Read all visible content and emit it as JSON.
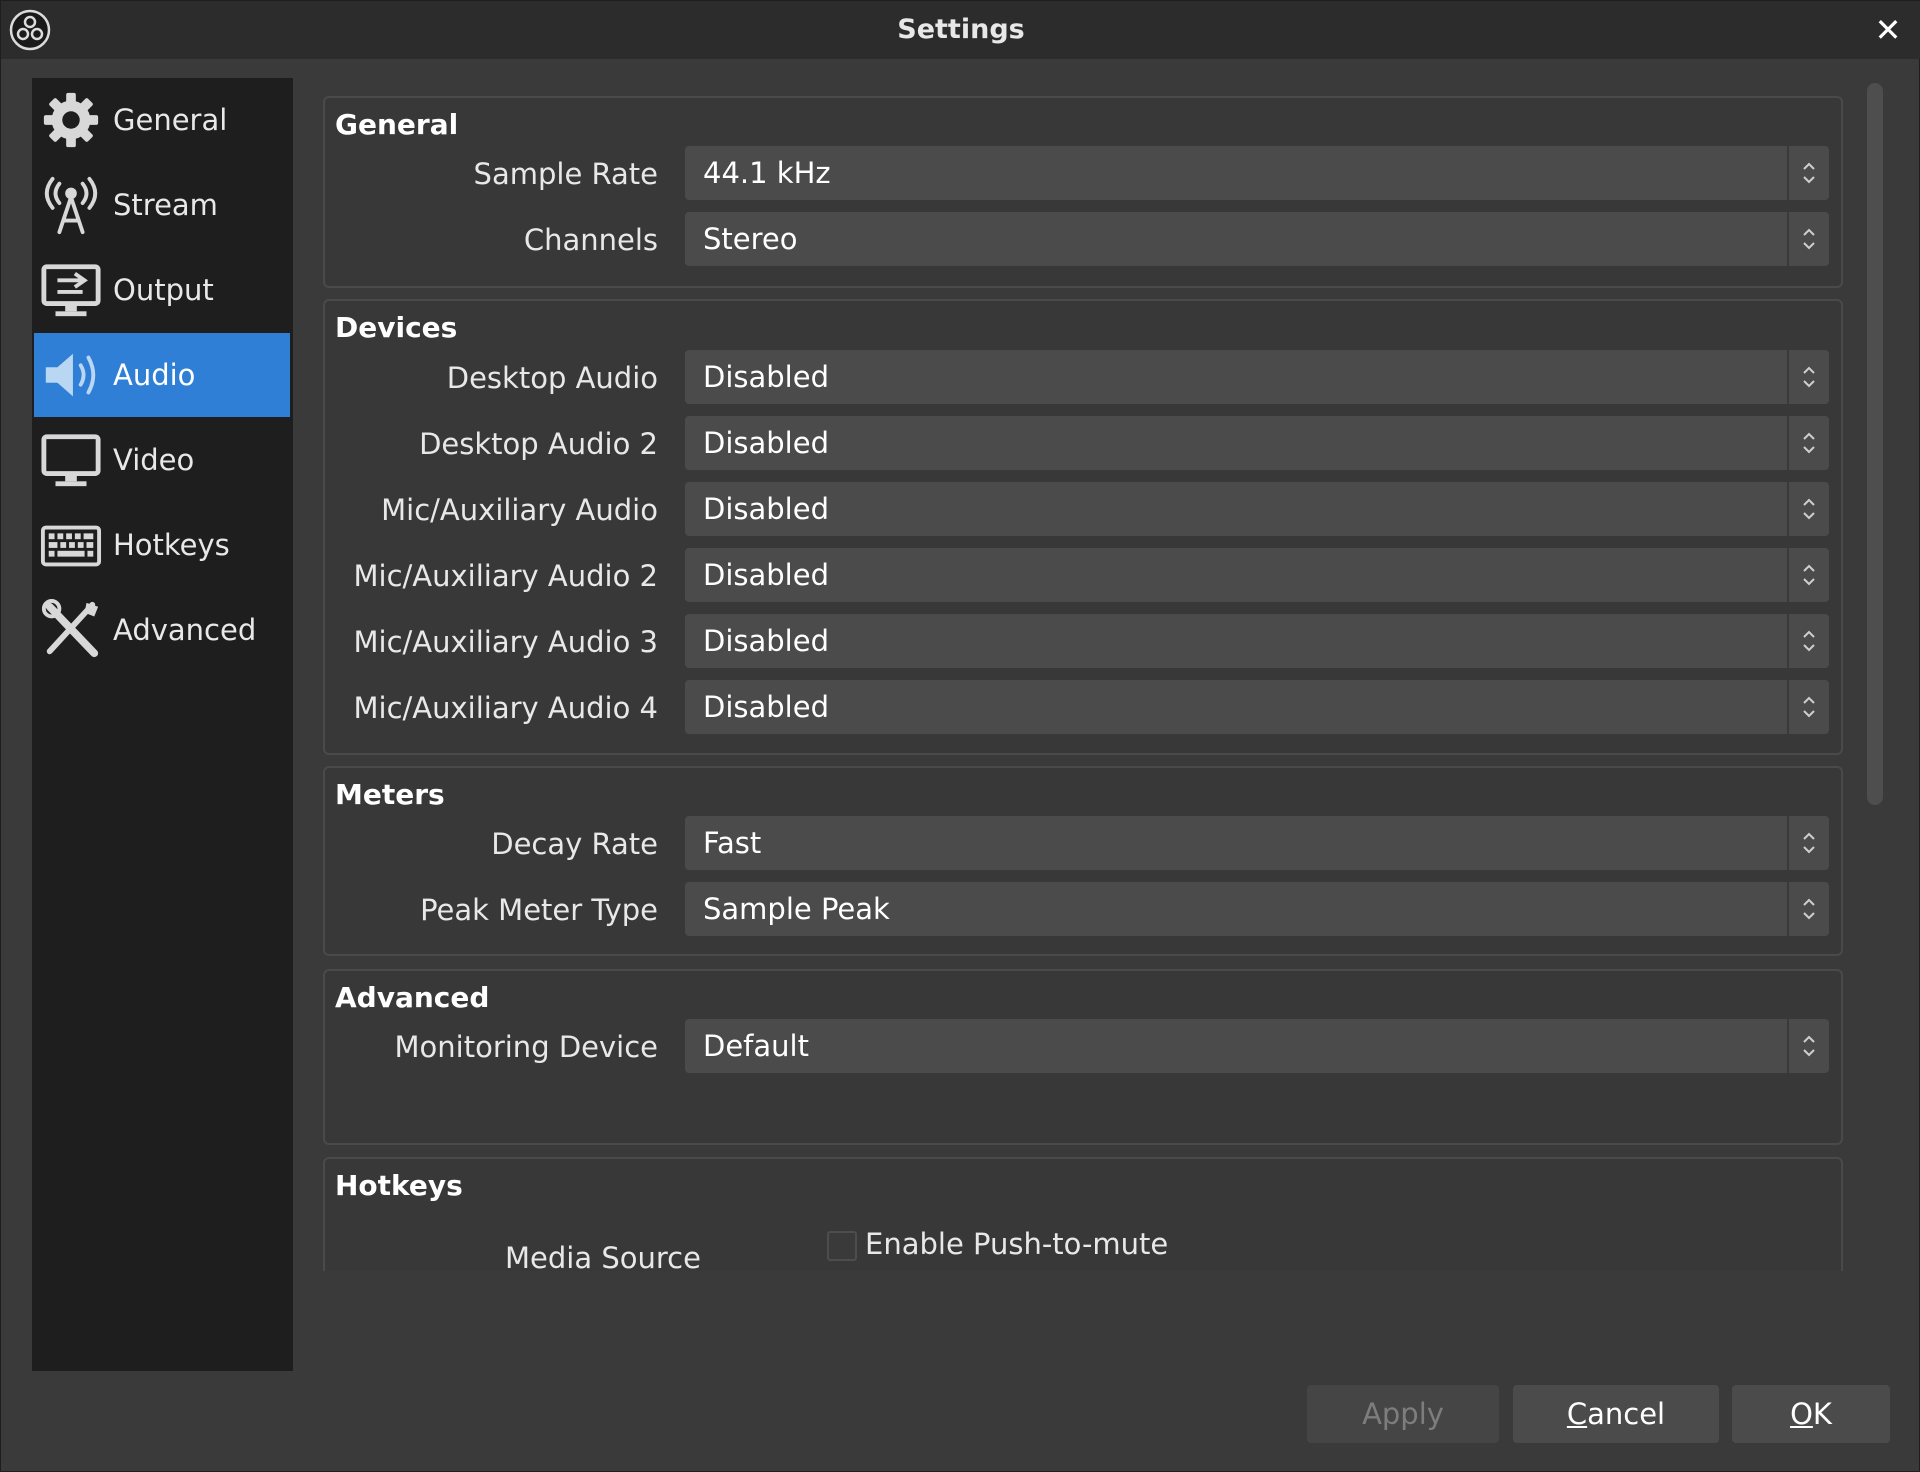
{
  "window": {
    "title": "Settings"
  },
  "sidebar": {
    "items": [
      {
        "label": "General",
        "icon": "gear-icon"
      },
      {
        "label": "Stream",
        "icon": "antenna-icon"
      },
      {
        "label": "Output",
        "icon": "output-icon"
      },
      {
        "label": "Audio",
        "icon": "speaker-icon",
        "selected": true
      },
      {
        "label": "Video",
        "icon": "monitor-icon"
      },
      {
        "label": "Hotkeys",
        "icon": "keyboard-icon"
      },
      {
        "label": "Advanced",
        "icon": "tools-icon"
      }
    ]
  },
  "sections": {
    "general": {
      "title": "General",
      "sample_rate": {
        "label": "Sample Rate",
        "value": "44.1 kHz"
      },
      "channels": {
        "label": "Channels",
        "value": "Stereo"
      }
    },
    "devices": {
      "title": "Devices",
      "desktop_audio": {
        "label": "Desktop Audio",
        "value": "Disabled"
      },
      "desktop_audio_2": {
        "label": "Desktop Audio 2",
        "value": "Disabled"
      },
      "mic_audio": {
        "label": "Mic/Auxiliary Audio",
        "value": "Disabled"
      },
      "mic_audio_2": {
        "label": "Mic/Auxiliary Audio 2",
        "value": "Disabled"
      },
      "mic_audio_3": {
        "label": "Mic/Auxiliary Audio 3",
        "value": "Disabled"
      },
      "mic_audio_4": {
        "label": "Mic/Auxiliary Audio 4",
        "value": "Disabled"
      }
    },
    "meters": {
      "title": "Meters",
      "decay_rate": {
        "label": "Decay Rate",
        "value": "Fast"
      },
      "peak_meter_type": {
        "label": "Peak Meter Type",
        "value": "Sample Peak"
      }
    },
    "advanced": {
      "title": "Advanced",
      "monitoring_device": {
        "label": "Monitoring Device",
        "value": "Default"
      }
    },
    "hotkeys": {
      "title": "Hotkeys",
      "source_label": "Media Source",
      "push_to_mute_label": "Enable Push-to-mute",
      "push_to_mute_checked": false
    }
  },
  "buttons": {
    "apply": "Apply",
    "cancel_pre": "",
    "cancel_mnemonic": "C",
    "cancel_post": "ancel",
    "ok_mnemonic": "O",
    "ok_post": "K"
  },
  "colors": {
    "accent": "#2f7fd6",
    "background": "#3a3a3a",
    "sidebar": "#1e1e1e",
    "combo": "#4b4b4b"
  }
}
